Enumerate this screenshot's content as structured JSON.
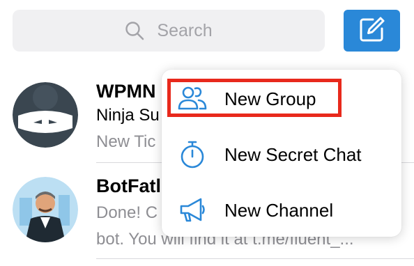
{
  "search": {
    "placeholder": "Search"
  },
  "chats": [
    {
      "name": "WPMN",
      "subtitle": "Ninja Su",
      "preview": "New Tic"
    },
    {
      "name": "BotFatl",
      "preview_line1": "Done! C",
      "preview_line2": "bot. You will find it at t.me/fluent_..."
    }
  ],
  "menu": {
    "items": [
      {
        "label": "New Group",
        "icon": "people-icon"
      },
      {
        "label": "New Secret Chat",
        "icon": "timer-icon"
      },
      {
        "label": "New Channel",
        "icon": "megaphone-icon"
      }
    ]
  },
  "colors": {
    "accent": "#2a88d8",
    "highlight": "#e8291c",
    "search_bg": "#f0f0f2",
    "secondary_text": "#8e8e93"
  }
}
